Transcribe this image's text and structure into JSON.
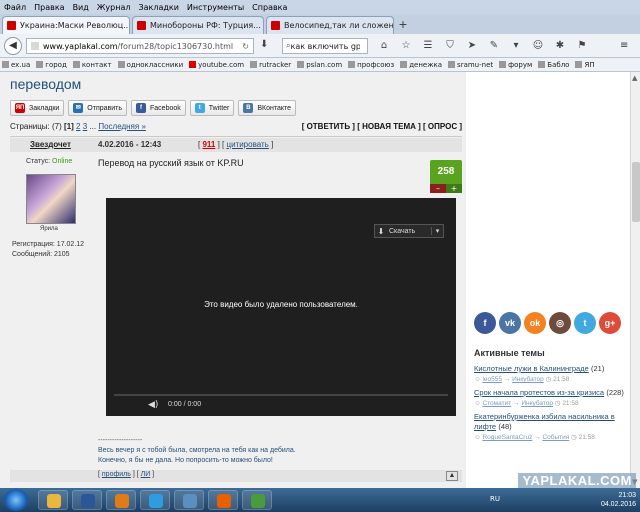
{
  "menu": [
    "Файл",
    "Правка",
    "Вид",
    "Журнал",
    "Закладки",
    "Инструменты",
    "Справка"
  ],
  "tabs": [
    {
      "label": "Украина:Маски Революц...",
      "active": true
    },
    {
      "label": "Минобороны РФ: Турция...",
      "active": false
    },
    {
      "label": "Велосипед,так ли сложен...",
      "active": false
    }
  ],
  "address": {
    "host": "www.yaplakal.com",
    "path": "/forum28/topic1306730.html"
  },
  "search": {
    "value": "как включить gps"
  },
  "bookmarks": [
    "ex.ua",
    "город",
    "контакт",
    "одноклассники",
    "youtube.com",
    "rutracker",
    "pslan.com",
    "профсоюз",
    "денежка",
    "sramu-net",
    "форум",
    "Бабло",
    "ЯП"
  ],
  "topic": {
    "title": "переводом"
  },
  "share": [
    "Закладки",
    "Отправить",
    "Facebook",
    "Twitter",
    "ВКонтакте"
  ],
  "pages": {
    "label": "Страницы:",
    "count": "(7)",
    "current": "[1]",
    "next": [
      "2",
      "3"
    ],
    "ellipsis": "...",
    "last": "Последняя »"
  },
  "actions": {
    "reply": "[ ОТВЕТИТЬ ]",
    "new_topic": "[ НОВАЯ ТЕМА ]",
    "poll": "[ ОПРОС ]"
  },
  "post": {
    "author": "Звездочет",
    "date": "4.02.2016 - 12:43",
    "number": "911",
    "quote_label": "цитировать",
    "status_label": "Статус:",
    "status": "Online",
    "avatar_caption": "Ярила",
    "registration": "Регистрация: 17.02.12",
    "messages": "Сообщений: 2105",
    "text": "Перевод на русский язык от KP.RU",
    "rating": "258",
    "signature_dash": "-------------------",
    "signature_1": "Весь вечер я с тобой была, смотрела на тебя как на дебила.",
    "signature_2": "Конечно, я бы не дала. Но попросить-то можно было!",
    "footer_profile": "профиль",
    "footer_pm": "ЛИ"
  },
  "video": {
    "download": "Скачать",
    "message": "Это видео было удалено пользователем.",
    "time": "0:00 / 0:00"
  },
  "sidebar": {
    "active_title": "Активные темы",
    "themes": [
      {
        "title": "Кислотные лужи в Калининграде",
        "count": "(21)",
        "author": "leo555",
        "arrow": "→",
        "last": "Инкубатор",
        "time": "21:58"
      },
      {
        "title": "Срок начала протестов из-за кризиса",
        "count": "(228)",
        "author": "Стоматит",
        "arrow": "→",
        "last": "Инкубатор",
        "time": "21:58"
      },
      {
        "title": "Екатеринбурженка избила насильника в лифте",
        "count": "(48)",
        "author": "RogueSantaCruz",
        "arrow": "→",
        "last": "События",
        "time": "21:58"
      }
    ]
  },
  "watermark": "YAPLAKAL.COM",
  "taskbar": {
    "lang": "RU",
    "time": "21:03",
    "date": "04.02.2016"
  }
}
